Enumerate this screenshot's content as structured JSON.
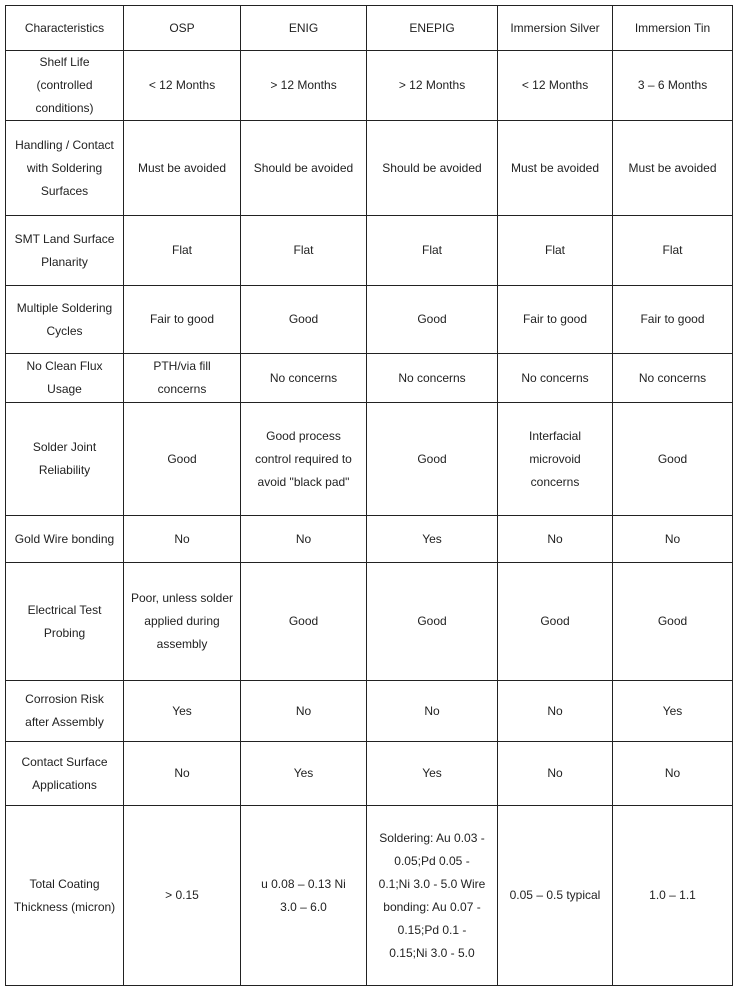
{
  "table": {
    "headers": [
      "Characteristics",
      "OSP",
      "ENIG",
      "ENEPIG",
      "Immersion Silver",
      "Immersion Tin"
    ],
    "rows": [
      [
        "Shelf Life (controlled conditions)",
        "< 12 Months",
        "> 12 Months",
        "> 12 Months",
        "< 12 Months",
        "3 – 6 Months"
      ],
      [
        "Handling / Contact with Soldering Surfaces",
        "Must be avoided",
        "Should be avoided",
        "Should be avoided",
        "Must be avoided",
        "Must be avoided"
      ],
      [
        "SMT Land Surface Planarity",
        "Flat",
        "Flat",
        "Flat",
        "Flat",
        "Flat"
      ],
      [
        "Multiple Soldering Cycles",
        "Fair to good",
        "Good",
        "Good",
        "Fair to good",
        "Fair to good"
      ],
      [
        "No Clean Flux Usage",
        "PTH/via fill concerns",
        "No concerns",
        "No concerns",
        "No concerns",
        "No concerns"
      ],
      [
        "Solder Joint Reliability",
        "Good",
        "Good process control required to avoid \"black pad\"",
        "Good",
        "Interfacial microvoid concerns",
        "Good"
      ],
      [
        "Gold Wire bonding",
        "No",
        "No",
        "Yes",
        "No",
        "No"
      ],
      [
        "Electrical Test Probing",
        "Poor, unless solder applied during assembly",
        "Good",
        "Good",
        "Good",
        "Good"
      ],
      [
        "Corrosion Risk after Assembly",
        "Yes",
        "No",
        "No",
        "No",
        "Yes"
      ],
      [
        "Contact Surface Applications",
        "No",
        "Yes",
        "Yes",
        "No",
        "No"
      ],
      [
        "Total Coating Thickness (micron)",
        "> 0.15",
        "u 0.08 – 0.13 Ni 3.0 – 6.0",
        "Soldering: Au 0.03 - 0.05;Pd 0.05 - 0.1;Ni 3.0 - 5.0 Wire bonding: Au 0.07 - 0.15;Pd 0.1 - 0.15;Ni 3.0 - 5.0",
        "0.05 – 0.5 typical",
        "1.0 – 1.1"
      ]
    ]
  }
}
